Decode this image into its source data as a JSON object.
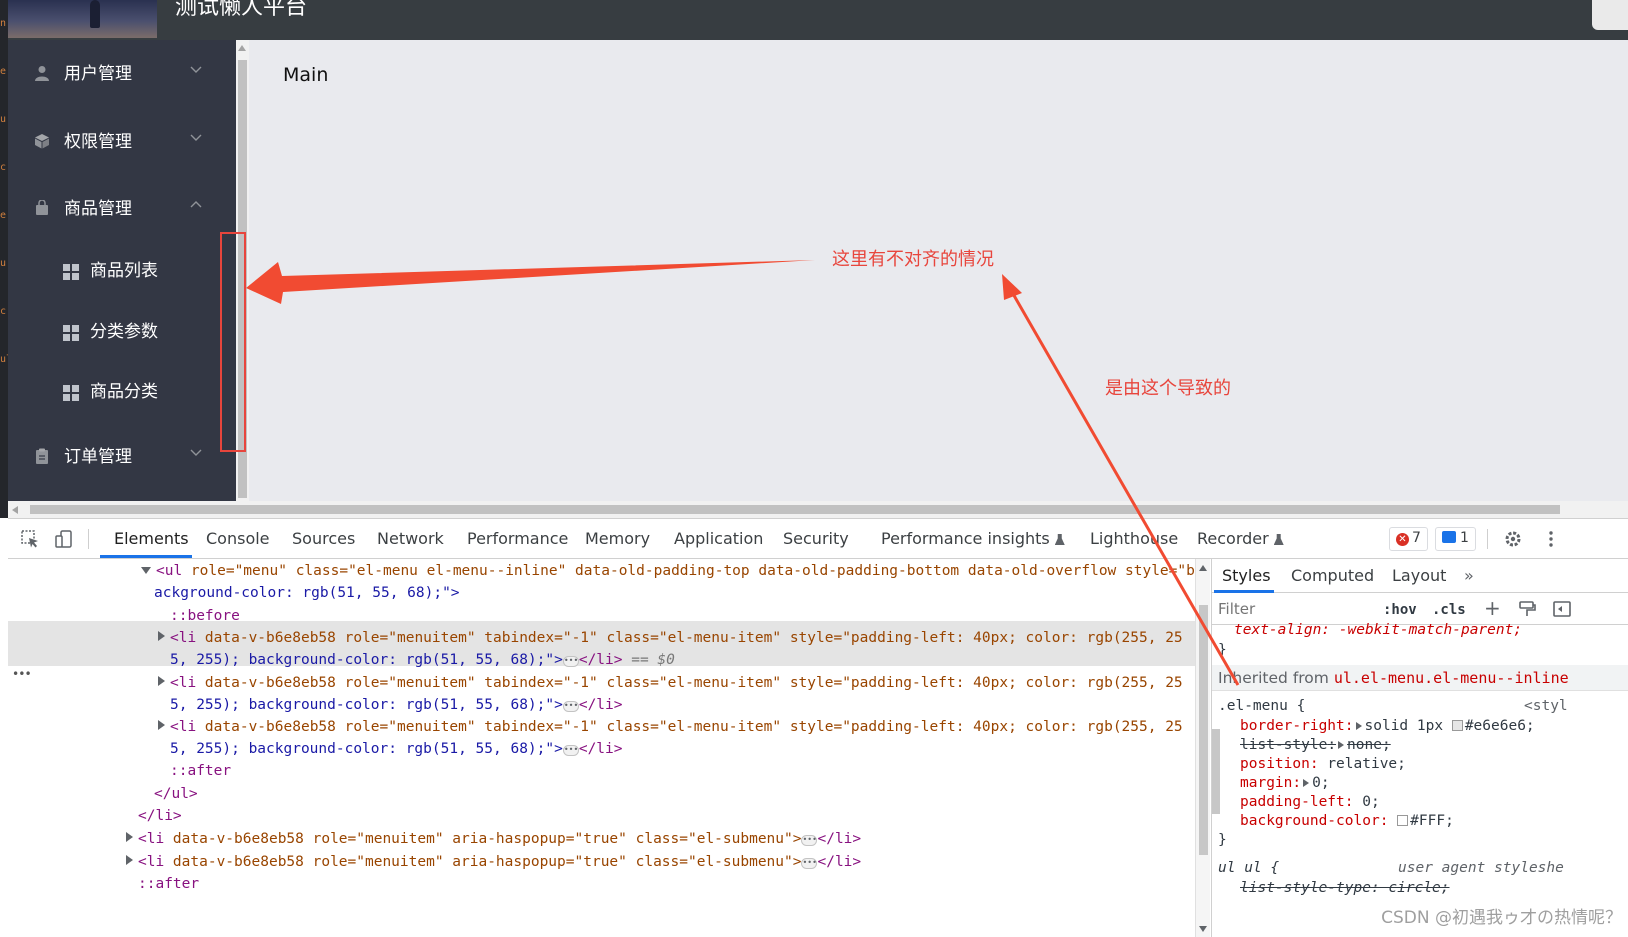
{
  "app": {
    "title": "测试懒人平台",
    "main_title": "Main",
    "menu": [
      {
        "label": "用户管理",
        "icon": "user-icon",
        "expanded": false
      },
      {
        "label": "权限管理",
        "icon": "box-icon",
        "expanded": false
      },
      {
        "label": "商品管理",
        "icon": "bag-icon",
        "expanded": true,
        "children": [
          {
            "label": "商品列表",
            "icon": "grid-icon"
          },
          {
            "label": "分类参数",
            "icon": "grid-icon"
          },
          {
            "label": "商品分类",
            "icon": "grid-icon"
          }
        ]
      },
      {
        "label": "订单管理",
        "icon": "clipboard-icon",
        "expanded": false
      }
    ],
    "colors": {
      "header": "#373d41",
      "sidebar": "#333744",
      "main": "#e9eaee",
      "annotation": "#e8453c"
    }
  },
  "annotations": {
    "misalign_note": "这里有不对齐的情况",
    "cause_note": "是由这个导致的"
  },
  "devtools": {
    "tabs": [
      "Elements",
      "Console",
      "Sources",
      "Network",
      "Performance",
      "Memory",
      "Application",
      "Security",
      "Performance insights",
      "Lighthouse",
      "Recorder"
    ],
    "active_tab": "Elements",
    "error_count": "7",
    "message_count": "1",
    "dom_lines": {
      "l1_attrs": " role=\"menu\" class=\"el-menu el-menu--inline\" data-old-padding-top data-old-padding-bottom data-old-overflow style=\"b",
      "l1_cont": "ackground-color: rgb(51, 55, 68);\">",
      "before": "::before",
      "li_attrs": " data-v-b6e8eb58 role=\"menuitem\" tabindex=\"-1\" class=\"el-menu-item\" style=\"padding-left: 40px; color: rgb(255, 25",
      "li_cont": "5, 255); background-color: rgb(51, 55, 68);\">",
      "selected_marker": "== $0",
      "after": "::after",
      "ul_close": "</ul>",
      "li_close": "</li>",
      "submenu_attrs": " data-v-b6e8eb58 role=\"menuitem\" aria-haspopup=\"true\" class=\"el-submenu\">",
      "after2": "::after"
    },
    "styles": {
      "tabs": [
        "Styles",
        "Computed",
        "Layout"
      ],
      "active_tab": "Styles",
      "filter_placeholder": "Filter",
      "hov": ":hov",
      "cls": ".cls",
      "top_rule": "text-align: -webkit-match-parent;",
      "inherited_label": "Inherited from",
      "inherited_selector": "ul.el-menu.el-menu--inline",
      "rule_selector": ".el-menu {",
      "rule_source": "<styl",
      "props": [
        {
          "name": "border-right",
          "value": "solid 1px",
          "color": "#e6e6e6",
          "struck": false,
          "expandable": true
        },
        {
          "name": "list-style",
          "value": "none;",
          "struck": true,
          "expandable": true
        },
        {
          "name": "position",
          "value": "relative;",
          "struck": false,
          "expandable": false
        },
        {
          "name": "margin",
          "value": "0;",
          "struck": false,
          "expandable": true
        },
        {
          "name": "padding-left",
          "value": "0;",
          "struck": false,
          "expandable": false
        },
        {
          "name": "background-color",
          "value": "#FFF;",
          "color": "#FFFFFF",
          "struck": false,
          "expandable": false
        }
      ],
      "close_brace": "}",
      "ua_selector": "ul ul {",
      "ua_source": "user agent styleshe",
      "ua_prop": "list-style-type: circle;",
      "watermark": "CSDN @初遇我ゥ才の热情呢？"
    }
  }
}
